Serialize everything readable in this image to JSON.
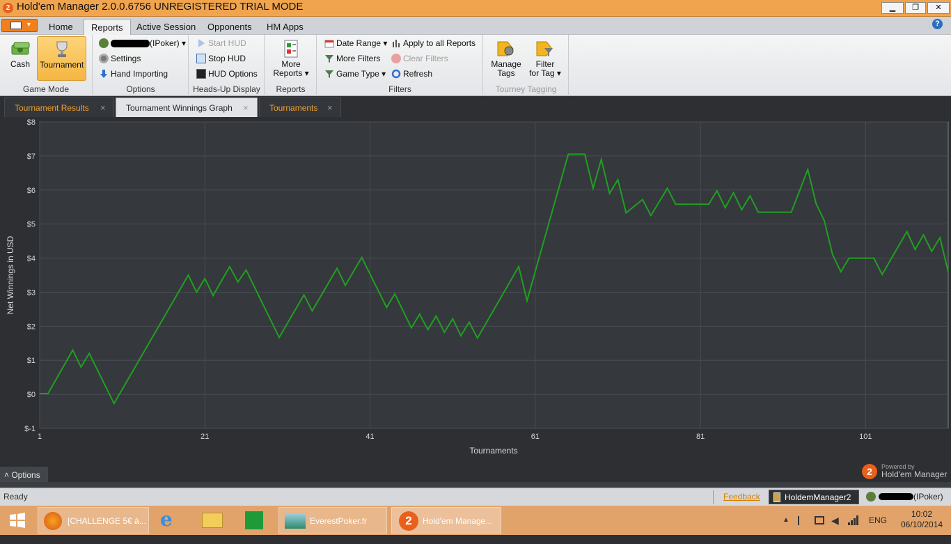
{
  "window": {
    "title": "Hold'em Manager 2.0.0.6756 UNREGISTERED TRIAL MODE",
    "app_icon": "2",
    "minimize": "▁",
    "restore": "❐",
    "close": "✕"
  },
  "menu": {
    "tabs": [
      "Home",
      "Reports",
      "Active Session",
      "Opponents",
      "HM Apps"
    ],
    "active_tab": "Reports",
    "help": "?"
  },
  "ribbon": {
    "game_mode": {
      "label": "Game Mode",
      "cash": "Cash",
      "tournament": "Tournament"
    },
    "options": {
      "label": "Options",
      "player_suffix": "(IPoker) ▾",
      "settings": "Settings",
      "hand_importing": "Hand Importing"
    },
    "hud": {
      "label": "Heads-Up Display",
      "start": "Start HUD",
      "stop": "Stop HUD",
      "options": "HUD Options"
    },
    "reports": {
      "label": "Reports",
      "more_line1": "More",
      "more_line2": "Reports ▾"
    },
    "filters": {
      "label": "Filters",
      "date_range": "Date Range ▾",
      "apply_all": "Apply to all Reports",
      "more_filters": "More Filters",
      "clear_filters": "Clear Filters",
      "game_type": "Game Type ▾",
      "refresh": "Refresh"
    },
    "tagging": {
      "label": "Tourney Tagging",
      "manage_line1": "Manage",
      "manage_line2": "Tags",
      "filter_line1": "Filter",
      "filter_line2": "for Tag ▾"
    }
  },
  "doc_tabs": [
    {
      "label": "Tournament Results",
      "active": false
    },
    {
      "label": "Tournament Winnings Graph",
      "active": true
    },
    {
      "label": "Tournaments",
      "active": false
    }
  ],
  "options_toggle": "˄  Options",
  "branding": {
    "powered_by": "Powered by",
    "name": "Hold'em Manager",
    "logo": "2"
  },
  "status": {
    "text": "Ready",
    "feedback": "Feedback",
    "db": "HoldemManager2",
    "player_suffix": "(IPoker)"
  },
  "taskbar": {
    "items": [
      "[CHALLENGE 5€ à...",
      "EverestPoker.fr",
      "Hold'em Manage..."
    ],
    "lang": "ENG",
    "time": "10:02",
    "date": "06/10/2014"
  },
  "colors": {
    "title_orange": "#f0a44d",
    "tab_orange": "#f0a030",
    "plot_bg": "#35383d",
    "line": "#1fa01f",
    "taskbar": "#e2a36b"
  },
  "chart_data": {
    "type": "line",
    "xlabel": "Tournaments",
    "ylabel": "Net Winnings in USD",
    "xlim": [
      1,
      111
    ],
    "ylim": [
      -1,
      8
    ],
    "xticks": [
      1,
      21,
      41,
      61,
      81,
      101
    ],
    "yticks": [
      -1,
      0,
      1,
      2,
      3,
      4,
      5,
      6,
      7,
      8
    ],
    "ytick_labels": [
      "$-1",
      "$0",
      "$1",
      "$2",
      "$3",
      "$4",
      "$5",
      "$6",
      "$7",
      "$8"
    ],
    "grid": true,
    "series": [
      {
        "x": [
          1,
          2,
          5,
          6,
          7,
          10,
          19,
          20,
          21,
          22,
          24,
          25,
          26,
          30,
          33,
          34,
          37,
          38,
          40,
          43,
          44,
          46,
          47,
          48,
          49,
          50,
          51,
          52,
          53,
          54,
          59,
          60,
          65,
          67,
          68,
          69,
          70,
          71,
          72,
          74,
          75,
          76,
          77,
          78,
          79,
          82,
          83,
          84,
          85,
          86,
          87,
          88,
          89,
          92,
          94,
          95,
          96,
          97,
          98,
          99,
          102,
          103,
          106,
          107,
          108,
          109,
          110,
          111
        ],
        "y": [
          0.02,
          0.02,
          1.3,
          0.8,
          1.2,
          -0.27,
          3.5,
          3.0,
          3.4,
          2.9,
          3.75,
          3.3,
          3.65,
          1.67,
          2.92,
          2.45,
          3.7,
          3.2,
          4.02,
          2.55,
          2.95,
          1.95,
          2.35,
          1.9,
          2.3,
          1.82,
          2.22,
          1.72,
          2.12,
          1.65,
          3.75,
          2.75,
          7.05,
          7.05,
          6.05,
          6.9,
          5.9,
          6.3,
          5.33,
          5.72,
          5.25,
          5.65,
          6.05,
          5.58,
          5.58,
          5.58,
          5.98,
          5.48,
          5.92,
          5.42,
          5.83,
          5.35,
          5.35,
          5.35,
          6.6,
          5.6,
          5.1,
          4.1,
          3.6,
          4.0,
          4.0,
          3.52,
          4.78,
          4.25,
          4.68,
          4.2,
          4.6,
          3.6
        ]
      }
    ]
  }
}
